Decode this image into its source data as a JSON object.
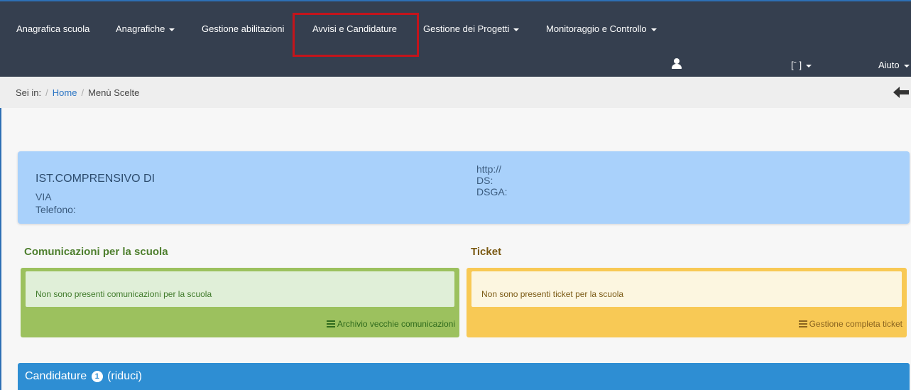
{
  "navbar": {
    "items": [
      {
        "label": "Anagrafica scuola",
        "dropdown": false
      },
      {
        "label": "Anagrafiche",
        "dropdown": true
      },
      {
        "label": "Gestione abilitazioni",
        "dropdown": false
      },
      {
        "label": "Avvisi e Candidature",
        "dropdown": false
      },
      {
        "label": "Gestione dei Progetti",
        "dropdown": true
      },
      {
        "label": "Monitoraggio e Controllo",
        "dropdown": true
      }
    ],
    "user_menu_label": "[ˉ        ]",
    "help_label": "Aiuto",
    "highlight_color": "#c4141b"
  },
  "breadcrumb": {
    "prefix": "Sei in:",
    "home": "Home",
    "current": "Menù Scelte"
  },
  "school": {
    "name": "IST.COMPRENSIVO DI",
    "address": "VIA",
    "phone_label": "Telefono:",
    "website": "http://",
    "ds_label": "DS:",
    "dsga_label": "DSGA:"
  },
  "communications": {
    "title": "Comunicazioni per la scuola",
    "message": "Non sono presenti comunicazioni per la scuola",
    "archive_link": "Archivio vecchie comunicazioni",
    "color": "#9cc15e"
  },
  "tickets": {
    "title": "Ticket",
    "message": "Non sono presenti ticket per la scuola",
    "manage_link": "Gestione completa ticket",
    "color": "#f8c955"
  },
  "candidature": {
    "title": "Candidature",
    "count": "1",
    "toggle_label": "(riduci)",
    "color": "#2e8ed3"
  },
  "icons": [
    "user-icon",
    "back-arrow-icon",
    "list-icon",
    "caret-down-icon"
  ]
}
